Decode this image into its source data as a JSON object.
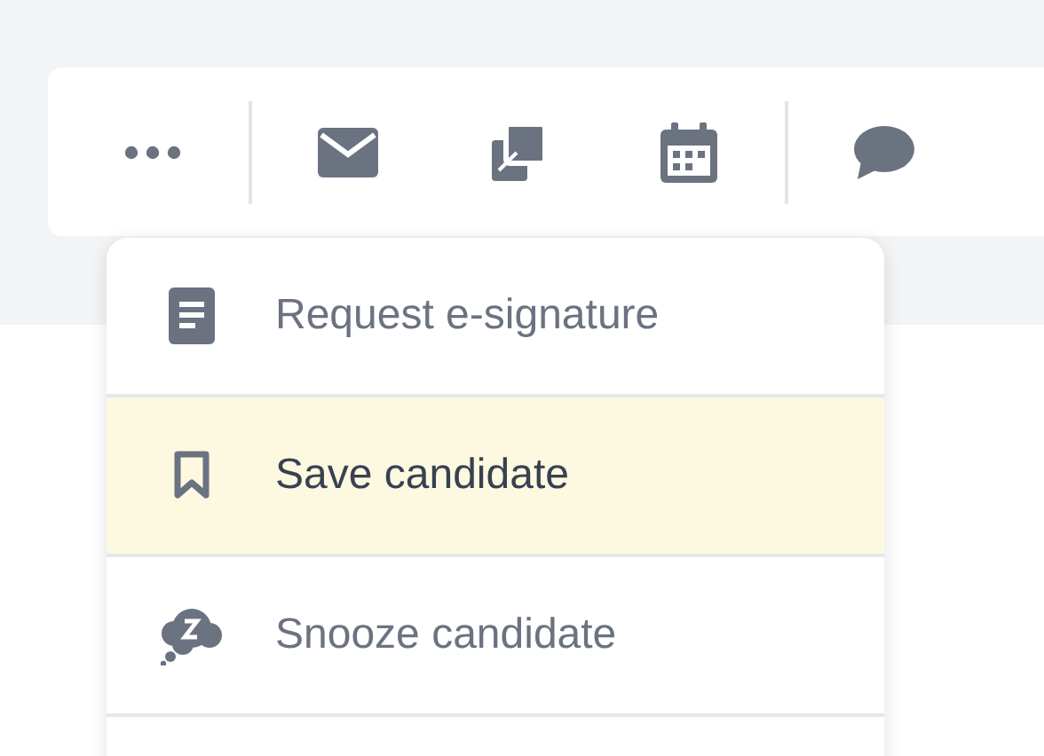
{
  "toolbar": {
    "groups": [
      {
        "buttons": [
          {
            "kind": "more"
          }
        ]
      },
      {
        "buttons": [
          {
            "kind": "mail"
          },
          {
            "kind": "copy"
          },
          {
            "kind": "calendar"
          }
        ]
      },
      {
        "buttons": [
          {
            "kind": "chat"
          }
        ]
      }
    ]
  },
  "menu": {
    "items": [
      {
        "label": "Request e-signature",
        "kind": "document",
        "selected": false
      },
      {
        "label": "Save candidate",
        "kind": "bookmark",
        "selected": true
      },
      {
        "label": "Snooze candidate",
        "kind": "snooze",
        "selected": false
      }
    ]
  }
}
